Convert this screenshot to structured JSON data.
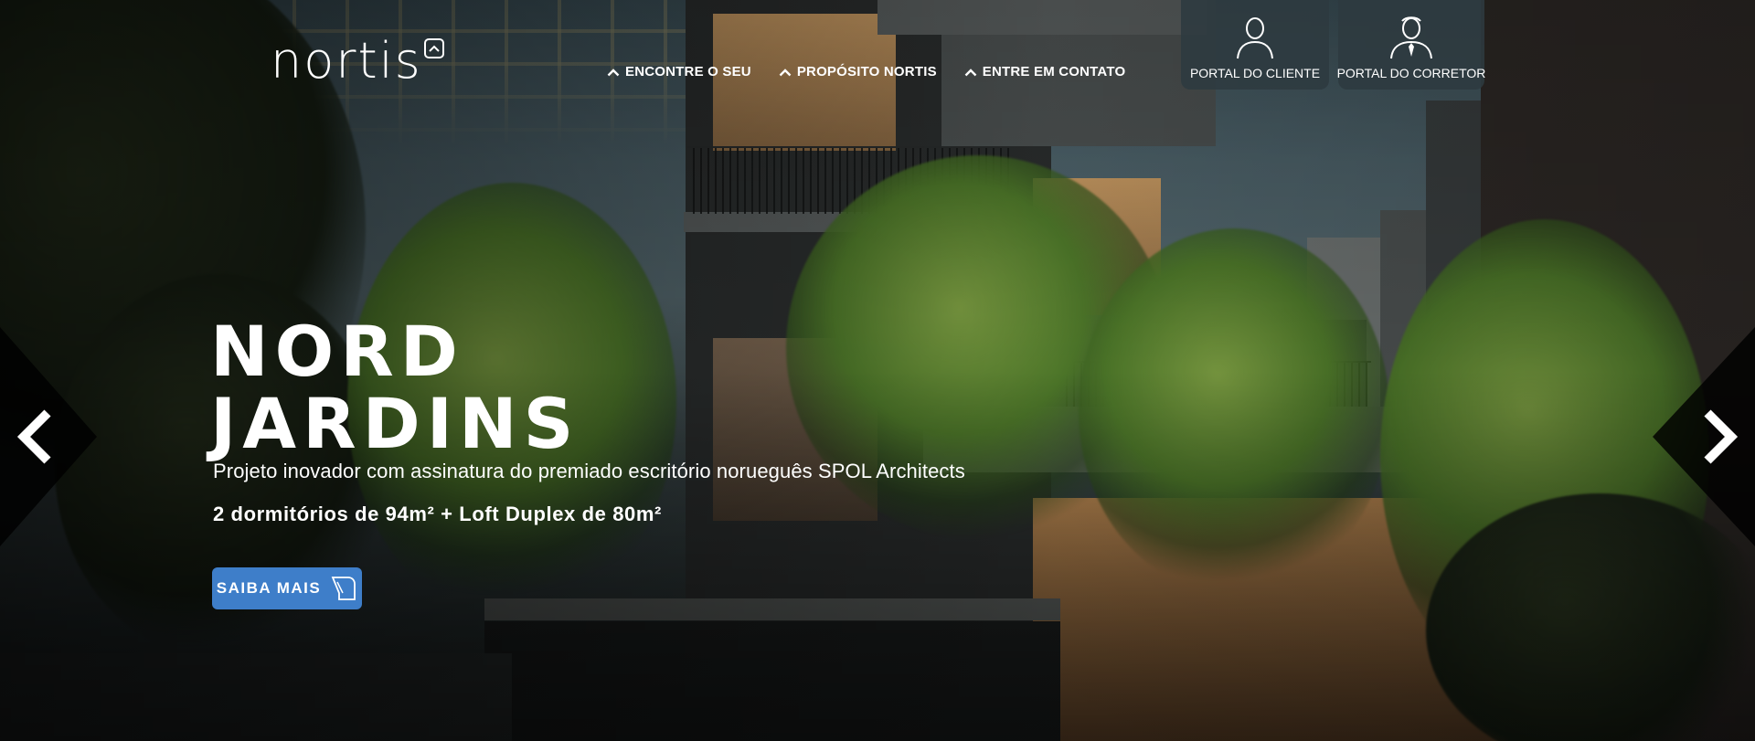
{
  "brand": {
    "logo_text": "nortis",
    "logo_icon": "chevron-up-badge-icon"
  },
  "nav": {
    "items": [
      {
        "label": "ENCONTRE O SEU",
        "icon": "chevron-up-icon"
      },
      {
        "label": "PROPÓSITO NORTIS",
        "icon": "chevron-up-icon"
      },
      {
        "label": "ENTRE EM CONTATO",
        "icon": "chevron-up-icon"
      }
    ]
  },
  "portals": {
    "client": {
      "label": "PORTAL DO CLIENTE",
      "icon": "user-icon"
    },
    "broker": {
      "label": "PORTAL DO CORRETOR",
      "icon": "user-tie-icon"
    }
  },
  "hero": {
    "title_line1": "NORD",
    "title_line2": "JARDINS",
    "subtitle": "Projeto inovador com assinatura do premiado escritório norueguês SPOL Architects",
    "spec": "2 dormitórios de 94m² + Loft Duplex de 80m²",
    "cta_label": "SAIBA MAIS",
    "cta_icon": "cursor-icon"
  },
  "carousel": {
    "prev_glyph": "‹",
    "next_glyph": "›"
  },
  "colors": {
    "accent": "#3e7ec9",
    "portal_bg": "#2d3a40"
  }
}
